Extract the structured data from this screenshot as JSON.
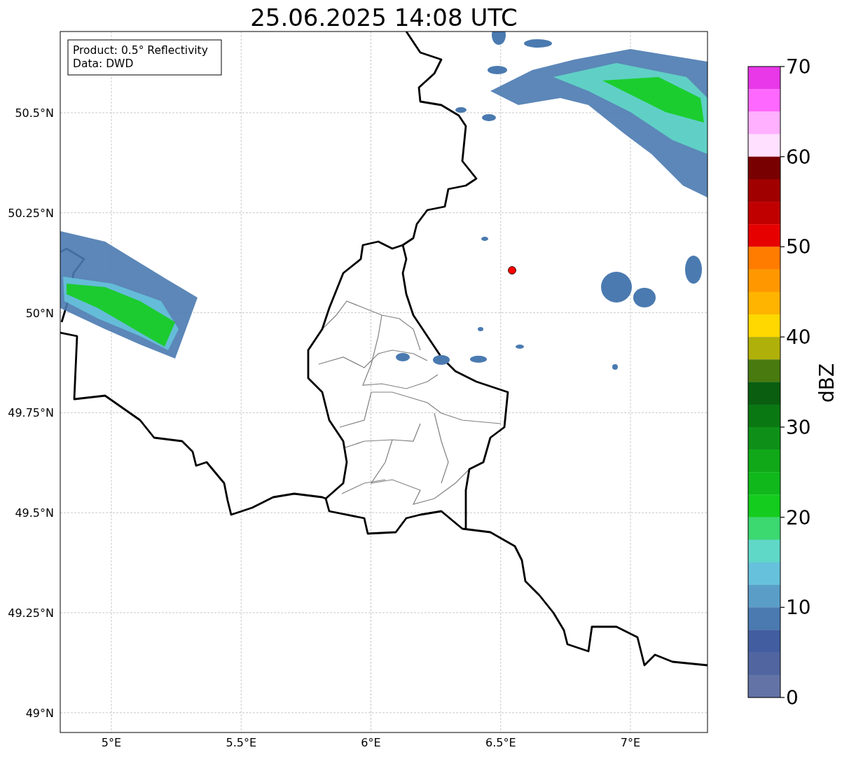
{
  "title": "25.06.2025 14:08 UTC",
  "legend": [
    "Product: 0.5° Reflectivity",
    "Data: DWD"
  ],
  "map": {
    "x_ticks": [
      "5°E",
      "5.5°E",
      "6°E",
      "6.5°E",
      "7°E"
    ],
    "y_ticks": [
      "50.5°N",
      "50.25°N",
      "50°N",
      "49.75°N",
      "49.5°N",
      "49.25°N",
      "49°N"
    ]
  },
  "colorbar": {
    "label": "dBZ",
    "ticks": [
      "70",
      "60",
      "50",
      "40",
      "30",
      "20",
      "10",
      "0"
    ],
    "segments": [
      {
        "color": "#e838e8"
      },
      {
        "color": "#ff68ff"
      },
      {
        "color": "#ffb0ff"
      },
      {
        "color": "#ffe0ff"
      },
      {
        "color": "#780000"
      },
      {
        "color": "#a00000"
      },
      {
        "color": "#c00000"
      },
      {
        "color": "#e60000"
      },
      {
        "color": "#ff7c00"
      },
      {
        "color": "#ff9800"
      },
      {
        "color": "#ffb400"
      },
      {
        "color": "#ffd800"
      },
      {
        "color": "#b0b00a"
      },
      {
        "color": "#487a10"
      },
      {
        "color": "#0a5e10"
      },
      {
        "color": "#0a7812"
      },
      {
        "color": "#0e9018"
      },
      {
        "color": "#10a818"
      },
      {
        "color": "#10b81c"
      },
      {
        "color": "#14cc1e"
      },
      {
        "color": "#3cd870"
      },
      {
        "color": "#60d8c8"
      },
      {
        "color": "#66c2dc"
      },
      {
        "color": "#5a9ec8"
      },
      {
        "color": "#4a7ab0"
      },
      {
        "color": "#425ea0"
      },
      {
        "color": "#5166a0"
      },
      {
        "color": "#6373a6"
      }
    ]
  }
}
